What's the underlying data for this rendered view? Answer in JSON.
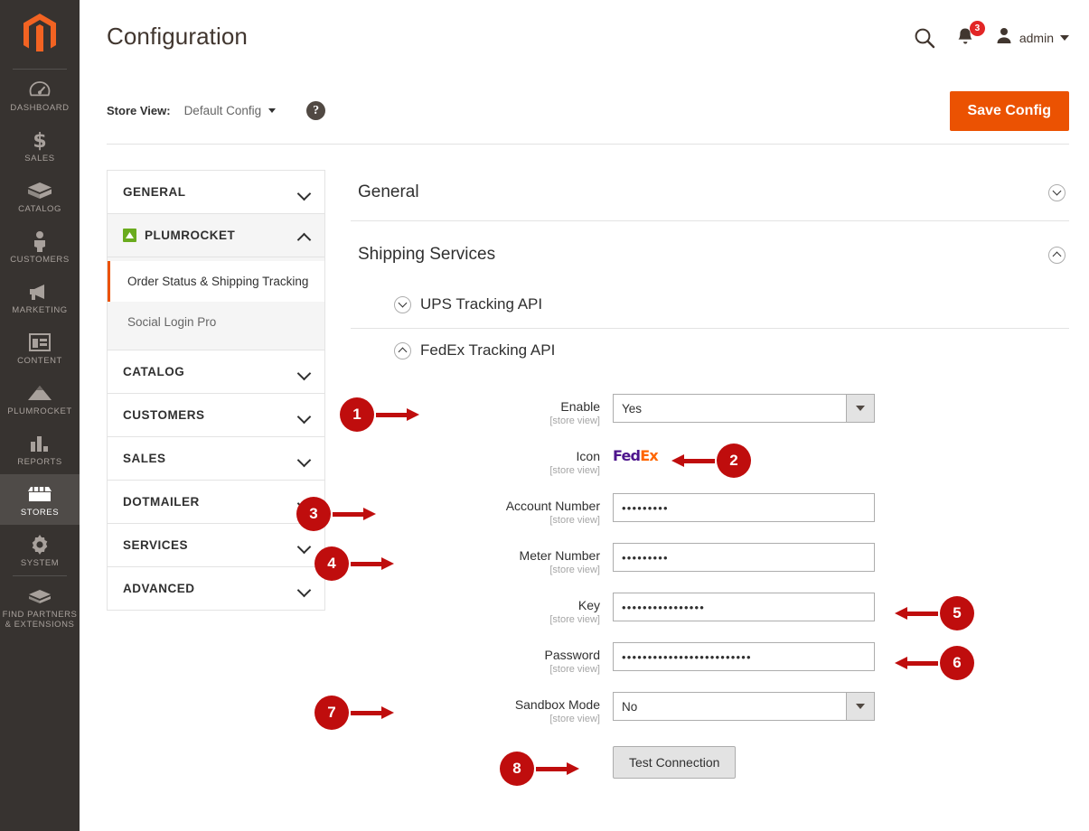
{
  "admin_nav": {
    "logo_name": "magento-logo",
    "items": [
      {
        "label": "DASHBOARD",
        "icon": "gauge-icon",
        "active": false
      },
      {
        "label": "SALES",
        "icon": "dollar-icon",
        "active": false
      },
      {
        "label": "CATALOG",
        "icon": "box-icon",
        "active": false
      },
      {
        "label": "CUSTOMERS",
        "icon": "person-icon",
        "active": false
      },
      {
        "label": "MARKETING",
        "icon": "megaphone-icon",
        "active": false
      },
      {
        "label": "CONTENT",
        "icon": "layout-icon",
        "active": false
      },
      {
        "label": "PLUMROCKET",
        "icon": "mountain-icon",
        "active": false
      },
      {
        "label": "REPORTS",
        "icon": "bar-chart-icon",
        "active": false
      },
      {
        "label": "STORES",
        "icon": "store-icon",
        "active": true
      },
      {
        "label": "SYSTEM",
        "icon": "gear-icon",
        "active": false
      },
      {
        "label": "FIND PARTNERS\n& EXTENSIONS",
        "icon": "plug-icon",
        "active": false
      }
    ]
  },
  "header": {
    "title": "Configuration",
    "search_icon": "search-icon",
    "notification_icon": "bell-icon",
    "notification_count": "3",
    "user_icon": "user-avatar-icon",
    "user_name": "admin"
  },
  "storeview": {
    "label": "Store View:",
    "value": "Default Config",
    "help_icon": "question-mark-icon",
    "save_label": "Save Config"
  },
  "config_nav": {
    "sections": [
      {
        "label": "GENERAL",
        "state": "collapsed",
        "icon": null
      },
      {
        "label": "PLUMROCKET",
        "state": "expanded",
        "icon": "plumrocket-icon"
      },
      {
        "label": "CATALOG",
        "state": "collapsed",
        "icon": null
      },
      {
        "label": "CUSTOMERS",
        "state": "collapsed",
        "icon": null
      },
      {
        "label": "SALES",
        "state": "collapsed",
        "icon": null
      },
      {
        "label": "DOTMAILER",
        "state": "collapsed",
        "icon": null
      },
      {
        "label": "SERVICES",
        "state": "collapsed",
        "icon": null
      },
      {
        "label": "ADVANCED",
        "state": "collapsed",
        "icon": null
      }
    ],
    "plumrocket_items": [
      {
        "label": "Order Status & Shipping Tracking",
        "current": true
      },
      {
        "label": "Social Login Pro",
        "current": false
      }
    ]
  },
  "content": {
    "sections": [
      {
        "label": "General",
        "state": "collapsed"
      },
      {
        "label": "Shipping Services",
        "state": "expanded"
      }
    ],
    "subsections": [
      {
        "label": "UPS Tracking API",
        "state": "collapsed"
      },
      {
        "label": "FedEx Tracking API",
        "state": "expanded"
      }
    ],
    "scope_note": "[store view]",
    "fields": [
      {
        "label": "Enable",
        "type": "select",
        "value": "Yes"
      },
      {
        "label": "Icon",
        "type": "logo",
        "value": "FedEx",
        "logo_first": "Fed",
        "logo_second": "Ex"
      },
      {
        "label": "Account Number",
        "type": "text",
        "value": "•••••••••"
      },
      {
        "label": "Meter Number",
        "type": "text",
        "value": "•••••••••"
      },
      {
        "label": "Key",
        "type": "text",
        "value": "••••••••••••••••"
      },
      {
        "label": "Password",
        "type": "text",
        "value": "•••••••••••••••••••••••••"
      },
      {
        "label": "Sandbox Mode",
        "type": "select",
        "value": "No"
      }
    ],
    "test_button": "Test Connection"
  },
  "annotations": [
    {
      "number": "1",
      "target": "Enable field",
      "direction": "right"
    },
    {
      "number": "2",
      "target": "Icon FedEx logo",
      "direction": "left"
    },
    {
      "number": "3",
      "target": "Account Number field",
      "direction": "right"
    },
    {
      "number": "4",
      "target": "Meter Number field",
      "direction": "right"
    },
    {
      "number": "5",
      "target": "Key field",
      "direction": "left"
    },
    {
      "number": "6",
      "target": "Password field",
      "direction": "left"
    },
    {
      "number": "7",
      "target": "Sandbox Mode field",
      "direction": "right"
    },
    {
      "number": "8",
      "target": "Test Connection",
      "direction": "right"
    }
  ],
  "colors": {
    "magento_orange": "#eb5202",
    "nav_dark": "#373330",
    "marker_red": "#bf0d0d",
    "badge_red": "#e22626",
    "plumrocket_green": "#6aab1e",
    "fedex_purple": "#4d148c",
    "fedex_orange": "#ff6600"
  }
}
